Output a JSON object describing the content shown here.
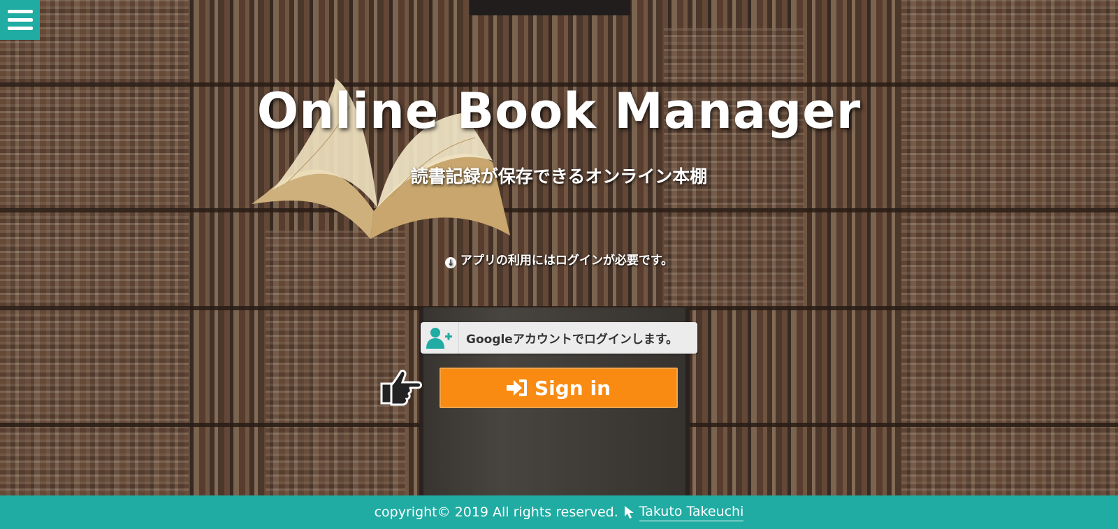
{
  "header": {
    "menu_icon": "hamburger-menu-icon"
  },
  "hero": {
    "title": "Online Book Manager",
    "subtitle": "読書記録が保存できるオンライン本棚",
    "notice": "アプリの利用にはログインが必要です。",
    "notice_icon": "arrow-down-circle-icon"
  },
  "login": {
    "google_label": "Googleアカウントでログインします。",
    "google_icon": "user-plus-icon",
    "pointer_icon": "hand-pointing-right-icon",
    "signin_label": "Sign in",
    "signin_icon": "sign-in-icon"
  },
  "footer": {
    "copyright": "copyright© 2019 All rights reserved.",
    "cursor_icon": "mouse-pointer-icon",
    "author": "Takuto Takeuchi"
  },
  "colors": {
    "accent": "#20aca3",
    "signin": "#f98b12",
    "google_icon": "#20aca3"
  }
}
